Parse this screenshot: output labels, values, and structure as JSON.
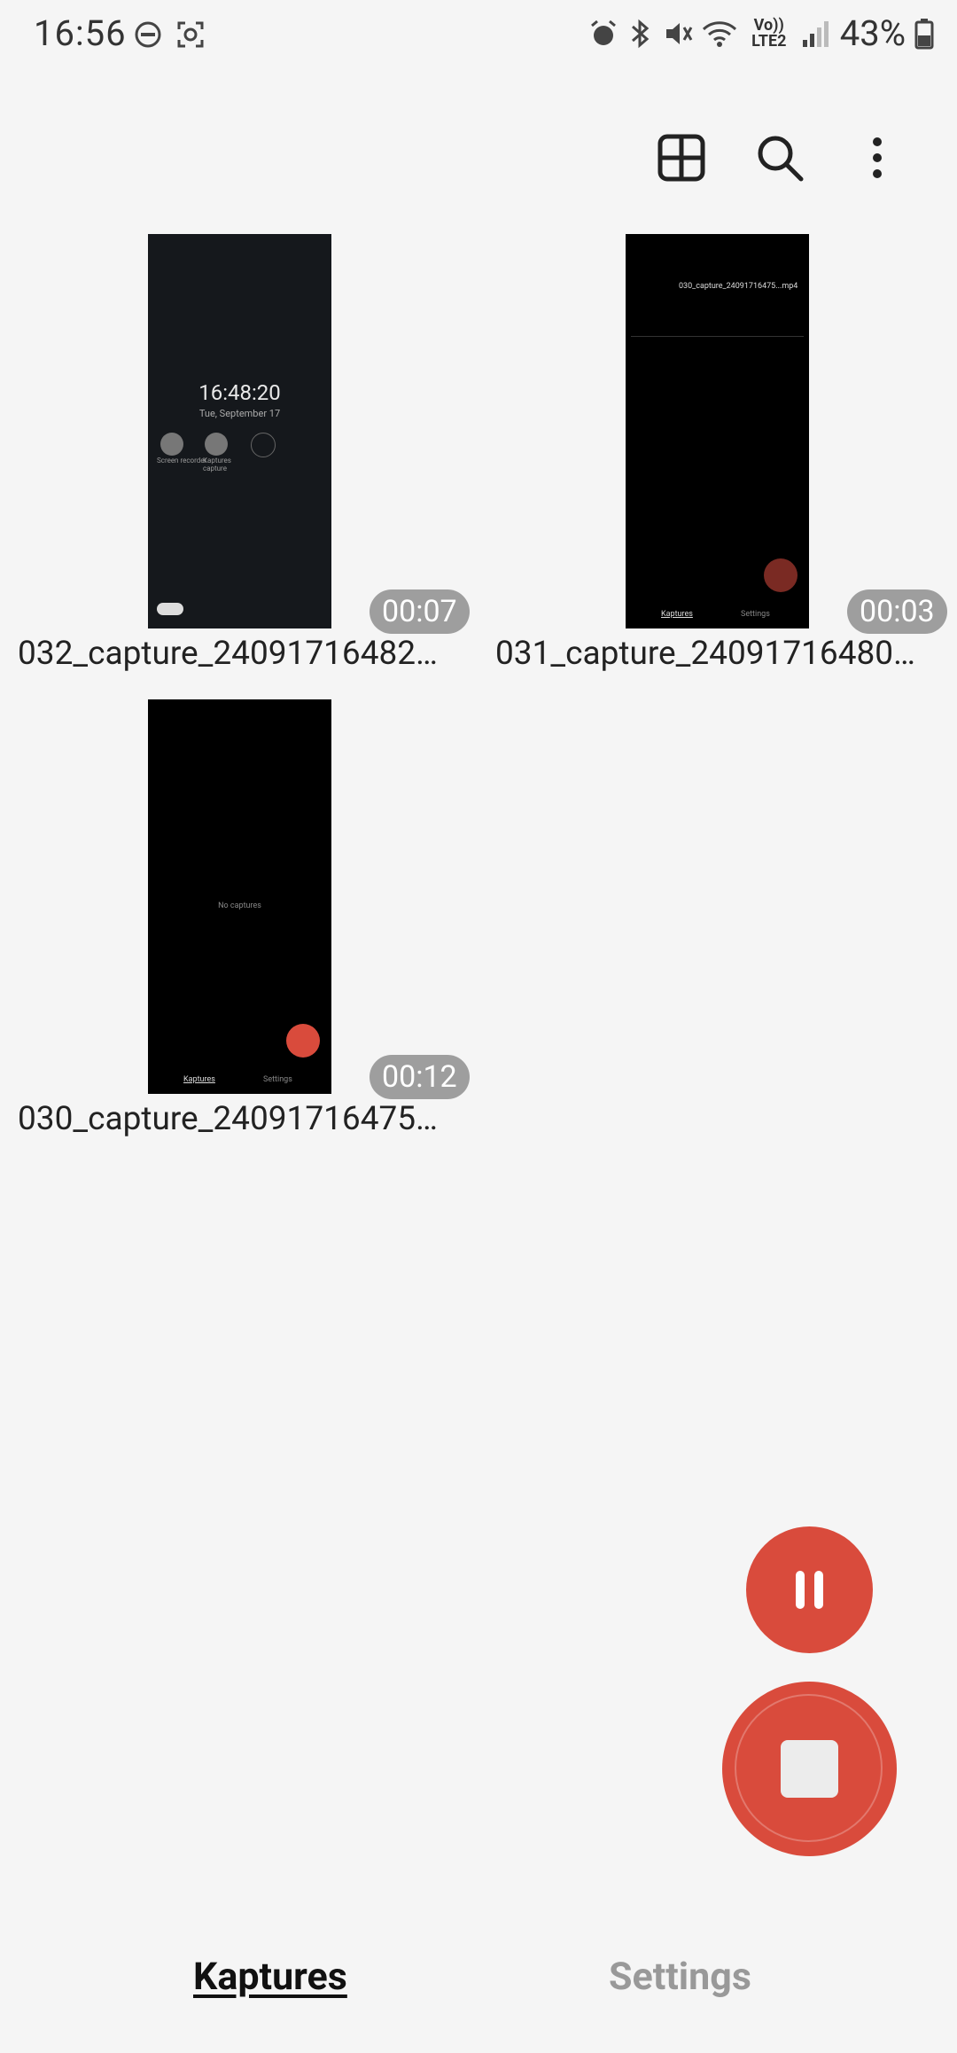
{
  "status_bar": {
    "time": "16:56",
    "battery_percent": "43%",
    "network": "Vo)) LTE2"
  },
  "toolbar": {
    "icons": [
      "grid-view-icon",
      "search-icon",
      "more-options-icon"
    ]
  },
  "captures": [
    {
      "filename": "032_capture_24091716482…",
      "duration": "00:07",
      "preview": {
        "clock": "16:48:20",
        "date": "Tue, September 17",
        "labels": [
          "Screen recorder",
          "Kaptures capture"
        ]
      }
    },
    {
      "filename": "031_capture_24091716480…",
      "duration": "00:03",
      "preview": {
        "file": "030_capture_24091716475...mp4",
        "tabs": [
          "Kaptures",
          "Settings"
        ]
      }
    },
    {
      "filename": "030_capture_24091716475…",
      "duration": "00:12",
      "preview": {
        "empty_text": "No captures",
        "tabs": [
          "Kaptures",
          "Settings"
        ]
      }
    }
  ],
  "controls": {
    "pause": "pause-icon",
    "stop": "stop-icon"
  },
  "bottom_nav": {
    "active": "Kaptures",
    "inactive": "Settings"
  }
}
